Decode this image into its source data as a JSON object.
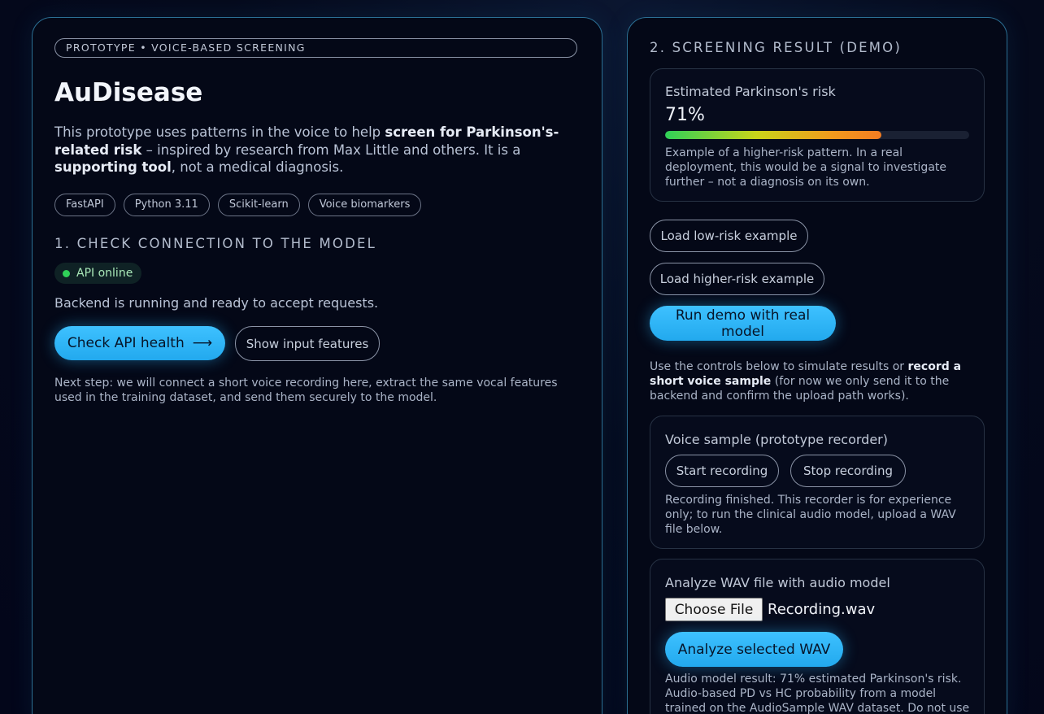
{
  "left": {
    "eyebrow": "PROTOTYPE • VOICE-BASED SCREENING",
    "title": "AuDisease",
    "intro": {
      "p1": "This prototype uses patterns in the voice to help ",
      "b1": "screen for Parkinson's-related risk",
      "p2": " – inspired by research from Max Little and others. It is a ",
      "b2": "supporting tool",
      "p3": ", not a medical diagnosis."
    },
    "tags": [
      "FastAPI",
      "Python 3.11",
      "Scikit-learn",
      "Voice biomarkers"
    ],
    "section1_title": "1. CHECK CONNECTION TO THE MODEL",
    "api_status": "API online",
    "backend_text": "Backend is running and ready to accept requests.",
    "check_api_label": "Check API health",
    "check_api_arrow": "⟶",
    "show_features_label": "Show input features",
    "next_step": "Next step: we will connect a short voice recording here, extract the same vocal features used in the training dataset, and send them securely to the model."
  },
  "right": {
    "section2_title": "2. SCREENING RESULT (DEMO)",
    "risk_label": "Estimated Parkinson's risk",
    "risk_value": "71%",
    "risk_fraction": 0.71,
    "risk_desc": "Example of a higher-risk pattern. In a real deployment, this would be a signal to investigate further – not a diagnosis on its own.",
    "load_low_label": "Load low-risk example",
    "load_high_label": "Load higher-risk example",
    "run_demo_label": "Run demo with real model",
    "controls_text": {
      "p1": "Use the controls below to simulate results or ",
      "b1": "record a short voice sample",
      "p2": " (for now we only send it to the backend and confirm the upload path works)."
    },
    "recorder_title": "Voice sample (prototype recorder)",
    "start_recording_label": "Start recording",
    "stop_recording_label": "Stop recording",
    "recorder_status": "Recording finished. This recorder is for experience only; to run the clinical audio model, upload a WAV file below.",
    "wav_title": "Analyze WAV file with audio model",
    "choose_file_label": "Choose File",
    "file_name": "Recording.wav",
    "analyze_label": "Analyze selected WAV",
    "audio_result": "Audio model result: 71% estimated Parkinson's risk. Audio-based PD vs HC probability from a model trained on the AudioSample WAV dataset. Do not use"
  },
  "colors": {
    "accent": "#2bb3f5",
    "online": "#30d158",
    "panel_border": "#2b6f93"
  }
}
